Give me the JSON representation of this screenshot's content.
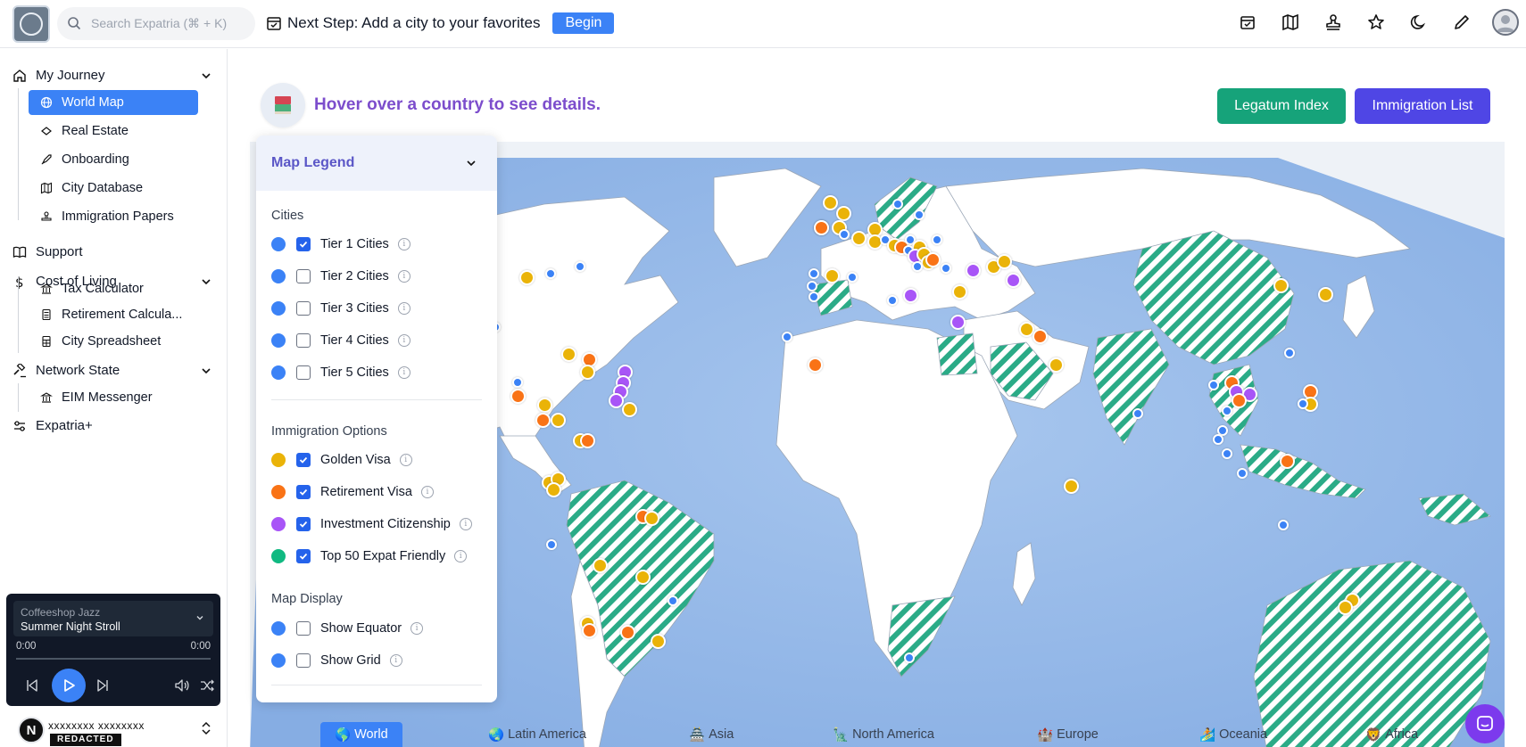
{
  "topbar": {
    "search_placeholder": "Search Expatria (⌘ + K)",
    "next_step": "Next Step: Add a city to your favorites",
    "begin_label": "Begin"
  },
  "sidebar": {
    "sections": [
      {
        "label": "My Journey",
        "items": [
          "World Map",
          "Real Estate",
          "Onboarding",
          "City Database",
          "Immigration Papers"
        ]
      },
      {
        "label": "Support"
      },
      {
        "label": "Cost of Living",
        "items": [
          "Tax Calculator",
          "Retirement Calcula...",
          "City Spreadsheet"
        ]
      },
      {
        "label": "Network State",
        "items": [
          "EIM Messenger"
        ]
      },
      {
        "label": "Expatria+"
      }
    ]
  },
  "player": {
    "playlist": "Coffeeshop Jazz",
    "song": "Summer Night Stroll",
    "time_current": "0:00",
    "time_total": "0:00"
  },
  "account": {
    "initial": "N",
    "name": "xxxxxxxx xxxxxxxx",
    "badge": "REDACTED"
  },
  "main": {
    "hint": "Hover over a country to see details.",
    "legatum_label": "Legatum Index",
    "immigration_label": "Immigration List"
  },
  "legend": {
    "title": "Map Legend",
    "cities_title": "Cities",
    "cities": [
      {
        "label": "Tier 1 Cities",
        "checked": true
      },
      {
        "label": "Tier 2 Cities",
        "checked": false
      },
      {
        "label": "Tier 3 Cities",
        "checked": false
      },
      {
        "label": "Tier 4 Cities",
        "checked": false
      },
      {
        "label": "Tier 5 Cities",
        "checked": false
      }
    ],
    "immigration_title": "Immigration Options",
    "immigration": [
      {
        "label": "Golden Visa",
        "checked": true,
        "color": "#eab308"
      },
      {
        "label": "Retirement Visa",
        "checked": true,
        "color": "#f97316"
      },
      {
        "label": "Investment Citizenship",
        "checked": true,
        "color": "#a855f7"
      },
      {
        "label": "Top 50 Expat Friendly",
        "checked": true,
        "color": "#10b981"
      }
    ],
    "display_title": "Map Display",
    "display": [
      {
        "label": "Show Equator",
        "checked": false
      },
      {
        "label": "Show Grid",
        "checked": false
      }
    ]
  },
  "regions": [
    {
      "label": "World",
      "emoji": "🌎"
    },
    {
      "label": "Latin America",
      "emoji": "🌏"
    },
    {
      "label": "Asia",
      "emoji": "🏯"
    },
    {
      "label": "North America",
      "emoji": "🗽"
    },
    {
      "label": "Europe",
      "emoji": "🏰"
    },
    {
      "label": "Oceania",
      "emoji": "🏄"
    },
    {
      "label": "Africa",
      "emoji": "🦁"
    }
  ],
  "colors": {
    "accent": "#3b82f6",
    "tier_dot": "#3b82f6",
    "ocean": "#8fb5e6",
    "land": "#ffffff",
    "stripe": "#2bab87"
  }
}
